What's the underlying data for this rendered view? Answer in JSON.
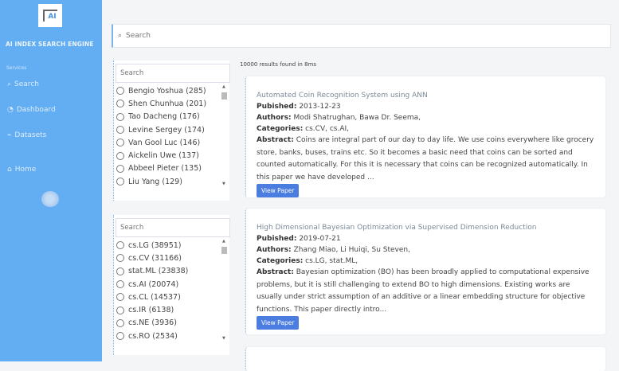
{
  "sidebar": {
    "logo": "AI",
    "brand": "AI INDEX SEARCH ENGINE",
    "section": "Services",
    "items": [
      {
        "icon": "search-icon",
        "label": "Search"
      },
      {
        "icon": "dashboard-icon",
        "label": "Dashboard"
      },
      {
        "icon": "datasets-icon",
        "label": "Datasets"
      },
      {
        "icon": "home-icon",
        "label": "Home"
      }
    ]
  },
  "search": {
    "placeholder": "Search"
  },
  "facets": [
    {
      "placeholder": "Search",
      "items": [
        "Bengio Yoshua (285)",
        "Shen Chunhua (201)",
        "Tao Dacheng (176)",
        "Levine Sergey (174)",
        "Van Gool Luc (146)",
        "Aickelin Uwe (137)",
        "Abbeel Pieter (135)",
        "Liu Yang (129)"
      ]
    },
    {
      "placeholder": "Search",
      "items": [
        "cs.LG (38951)",
        "cs.CV (31166)",
        "stat.ML (23838)",
        "cs.AI (20074)",
        "cs.CL (14537)",
        "cs.IR (6138)",
        "cs.NE (3936)",
        "cs.RO (2534)"
      ]
    }
  ],
  "results_count": "10000 results found in 8ms",
  "labels": {
    "published": "Pubished:",
    "authors": "Authors:",
    "categories": "Categories:",
    "abstract": "Abstract:",
    "view": "View Paper"
  },
  "results": [
    {
      "title": "Automated Coin Recognition System using ANN",
      "published": "2013-12-23",
      "authors": "Modi Shatrughan, Bawa Dr. Seema,",
      "categories": "cs.CV, cs.AI,",
      "abstract": "Coins are integral part of our day to day life. We use coins everywhere like grocery store, banks, buses, trains etc. So it becomes a basic need that coins can be sorted and counted automatically. For this it is necessary that coins can be recognized automatically. In this paper we have developed ..."
    },
    {
      "title": "High Dimensional Bayesian Optimization via Supervised Dimension Reduction",
      "published": "2019-07-21",
      "authors": "Zhang Miao, Li Huiqi, Su Steven,",
      "categories": "cs.LG, stat.ML,",
      "abstract": "Bayesian optimization (BO) has been broadly applied to computational expensive problems, but it is still challenging to extend BO to high dimensions. Existing works are usually under strict assumption of an additive or a linear embedding structure for objective functions. This paper directly intro..."
    }
  ]
}
